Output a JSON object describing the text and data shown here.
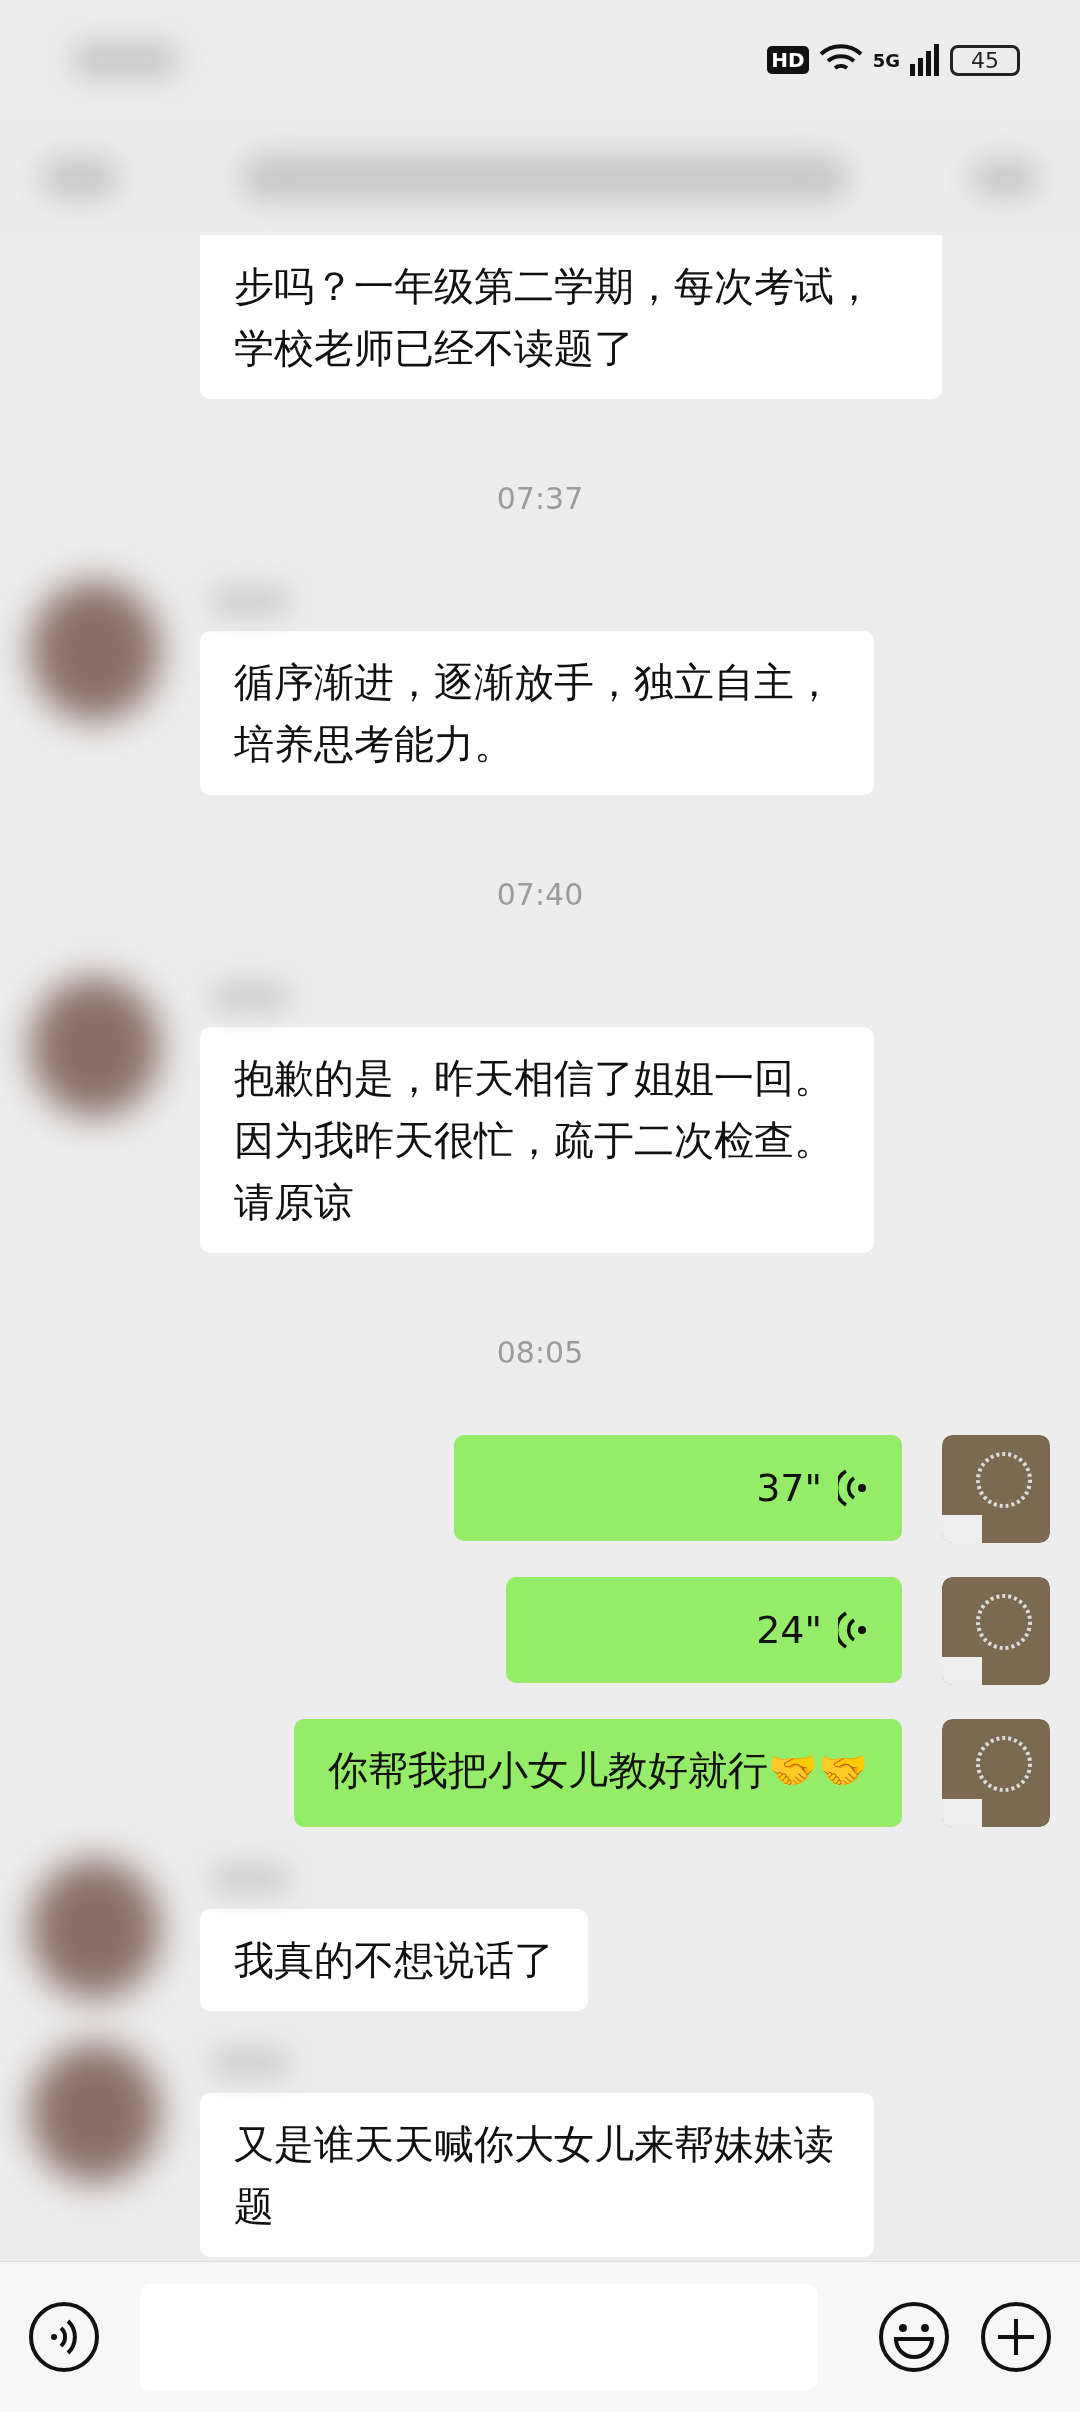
{
  "status_bar": {
    "hd": "HD",
    "network": "5G",
    "battery": "45"
  },
  "messages": [
    {
      "kind": "received_text",
      "text": "步吗？一年级第二学期，每次考试，学校老师已经不读题了"
    },
    {
      "kind": "time",
      "text": "07:37"
    },
    {
      "kind": "received_text",
      "text": "循序渐进，逐渐放手，独立自主，培养思考能力。"
    },
    {
      "kind": "time",
      "text": "07:40"
    },
    {
      "kind": "received_text",
      "text": "抱歉的是，昨天相信了姐姐一回。因为我昨天很忙，疏于二次检查。请原谅"
    },
    {
      "kind": "time",
      "text": "08:05"
    },
    {
      "kind": "sent_voice",
      "duration": "37\""
    },
    {
      "kind": "sent_voice",
      "duration": "24\""
    },
    {
      "kind": "sent_text",
      "text": "你帮我把小女儿教好就行🤝🤝"
    },
    {
      "kind": "received_text",
      "text": "我真的不想说话了"
    },
    {
      "kind": "received_text",
      "text": "又是谁天天喊你大女儿来帮妹妹读题"
    }
  ]
}
